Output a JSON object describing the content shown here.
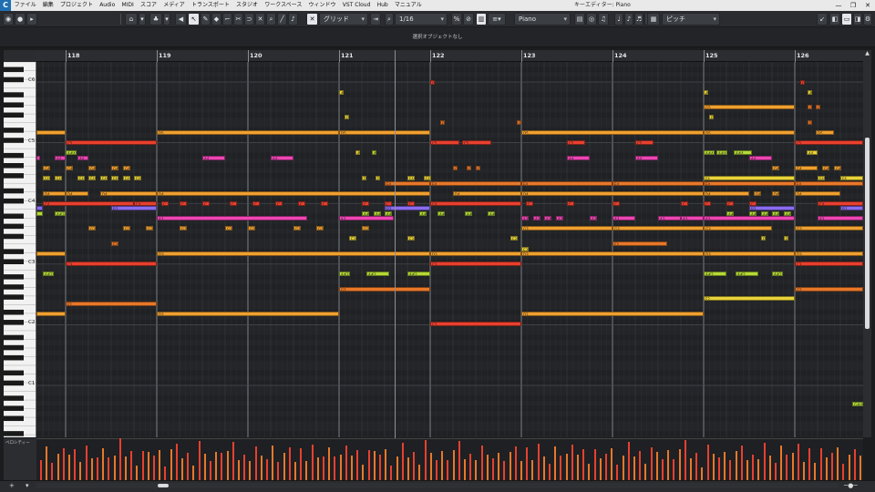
{
  "app": {
    "logo": "C",
    "window_title": "キーエディター: Piano",
    "window_buttons": [
      "—",
      "❐",
      "✕"
    ]
  },
  "menu": [
    "ファイル",
    "編集",
    "プロジェクト",
    "Audio",
    "MIDI",
    "スコア",
    "メディア",
    "トランスポート",
    "スタジオ",
    "ワークスペース",
    "ウィンドウ",
    "VST Cloud",
    "Hub",
    "マニュアル"
  ],
  "toolbar": {
    "snap_type": "グリッド",
    "quantize": "1/16",
    "track": "Piano",
    "controller": "ピッチ"
  },
  "infobar": {
    "text": "選択オブジェクトなし"
  },
  "ruler": {
    "bars": [
      "118",
      "119",
      "120",
      "121",
      "122",
      "123",
      "124",
      "125",
      "126"
    ]
  },
  "keyboard": {
    "labels": [
      "C6",
      "C5",
      "C4",
      "C3",
      "C2",
      "C1"
    ]
  },
  "velocity_lane": {
    "label": "ベロシティー"
  },
  "colors": {
    "orange": "#f0a030",
    "red": "#e8402f",
    "pink": "#ee45b4",
    "yellow": "#e8d33a",
    "lime": "#b4d936",
    "purple": "#8a6cf0",
    "dark_orange": "#e8782a"
  },
  "notes": {
    "note_c6": "C6",
    "note_a5": "A5",
    "note_g5": "G5",
    "note_f5": "F5",
    "note_d5": "D5",
    "note_c5": "C5",
    "note_as4": "A#4",
    "note_a4": "A4",
    "note_f4": "F4",
    "note_d4": "D4",
    "note_c4": "C4",
    "note_as3": "A#3",
    "note_a3": "A3",
    "note_g3": "G3",
    "note_f3": "F3",
    "note_d3": "D3",
    "note_c3": "C3",
    "note_as2": "A#2",
    "note_g2": "G2",
    "note_f2": "F2",
    "note_d2": "D2",
    "note_c2": "C2",
    "note_gs0": "G#0"
  }
}
